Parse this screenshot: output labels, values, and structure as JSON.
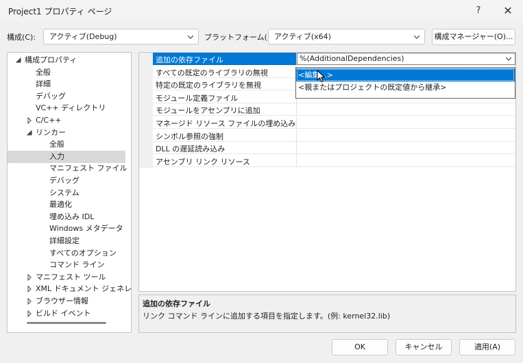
{
  "window": {
    "title": "Project1 プロパティ ページ",
    "help_label": "?",
    "close_label": "✕"
  },
  "toolbar": {
    "config_label": "構成(C):",
    "config_value": "アクティブ(Debug)",
    "platform_label": "プラットフォーム(P):",
    "platform_value": "アクティブ(x64)",
    "config_manager_label": "構成マネージャー(O)..."
  },
  "tree": {
    "items": [
      {
        "label": "構成プロパティ",
        "level": 0,
        "state": "expanded"
      },
      {
        "label": "全般",
        "level": 1,
        "state": "leaf"
      },
      {
        "label": "詳細",
        "level": 1,
        "state": "leaf"
      },
      {
        "label": "デバッグ",
        "level": 1,
        "state": "leaf"
      },
      {
        "label": "VC++ ディレクトリ",
        "level": 1,
        "state": "leaf"
      },
      {
        "label": "C/C++",
        "level": 1,
        "state": "collapsed"
      },
      {
        "label": "リンカー",
        "level": 1,
        "state": "expanded"
      },
      {
        "label": "全般",
        "level": 2,
        "state": "leaf"
      },
      {
        "label": "入力",
        "level": 2,
        "state": "leaf",
        "selected": true
      },
      {
        "label": "マニフェスト ファイル",
        "level": 2,
        "state": "leaf"
      },
      {
        "label": "デバッグ",
        "level": 2,
        "state": "leaf"
      },
      {
        "label": "システム",
        "level": 2,
        "state": "leaf"
      },
      {
        "label": "最適化",
        "level": 2,
        "state": "leaf"
      },
      {
        "label": "埋め込み IDL",
        "level": 2,
        "state": "leaf"
      },
      {
        "label": "Windows メタデータ",
        "level": 2,
        "state": "leaf"
      },
      {
        "label": "詳細設定",
        "level": 2,
        "state": "leaf"
      },
      {
        "label": "すべてのオプション",
        "level": 2,
        "state": "leaf"
      },
      {
        "label": "コマンド ライン",
        "level": 2,
        "state": "leaf"
      },
      {
        "label": "マニフェスト ツール",
        "level": 1,
        "state": "collapsed"
      },
      {
        "label": "XML ドキュメント ジェネレー",
        "level": 1,
        "state": "collapsed"
      },
      {
        "label": "ブラウザー情報",
        "level": 1,
        "state": "collapsed"
      },
      {
        "label": "ビルド イベント",
        "level": 1,
        "state": "collapsed"
      }
    ]
  },
  "properties": {
    "rows": [
      {
        "name": "追加の依存ファイル",
        "value": "%(AdditionalDependencies)",
        "selected": true
      },
      {
        "name": "すべての既定のライブラリの無視",
        "value": ""
      },
      {
        "name": "特定の既定のライブラリを無視",
        "value": ""
      },
      {
        "name": "モジュール定義ファイル",
        "value": ""
      },
      {
        "name": "モジュールをアセンブリに追加",
        "value": ""
      },
      {
        "name": "マネージド リソース ファイルの埋め込み",
        "value": ""
      },
      {
        "name": "シンボル参照の強制",
        "value": ""
      },
      {
        "name": "DLL の遅延読み込み",
        "value": ""
      },
      {
        "name": "アセンブリ リンク リソース",
        "value": ""
      }
    ]
  },
  "dropdown": {
    "options": [
      {
        "label": "<編集...>",
        "selected": true
      },
      {
        "label": "<親またはプロジェクトの既定値から継承>"
      }
    ]
  },
  "description": {
    "title": "追加の依存ファイル",
    "text": "リンク コマンド ラインに追加する項目を指定します。(例: kernel32.lib)"
  },
  "buttons": {
    "ok": "OK",
    "cancel": "キャンセル",
    "apply": "適用(A)"
  },
  "colors": {
    "accent": "#0078d4",
    "tree_selection": "#d9d9d9"
  }
}
